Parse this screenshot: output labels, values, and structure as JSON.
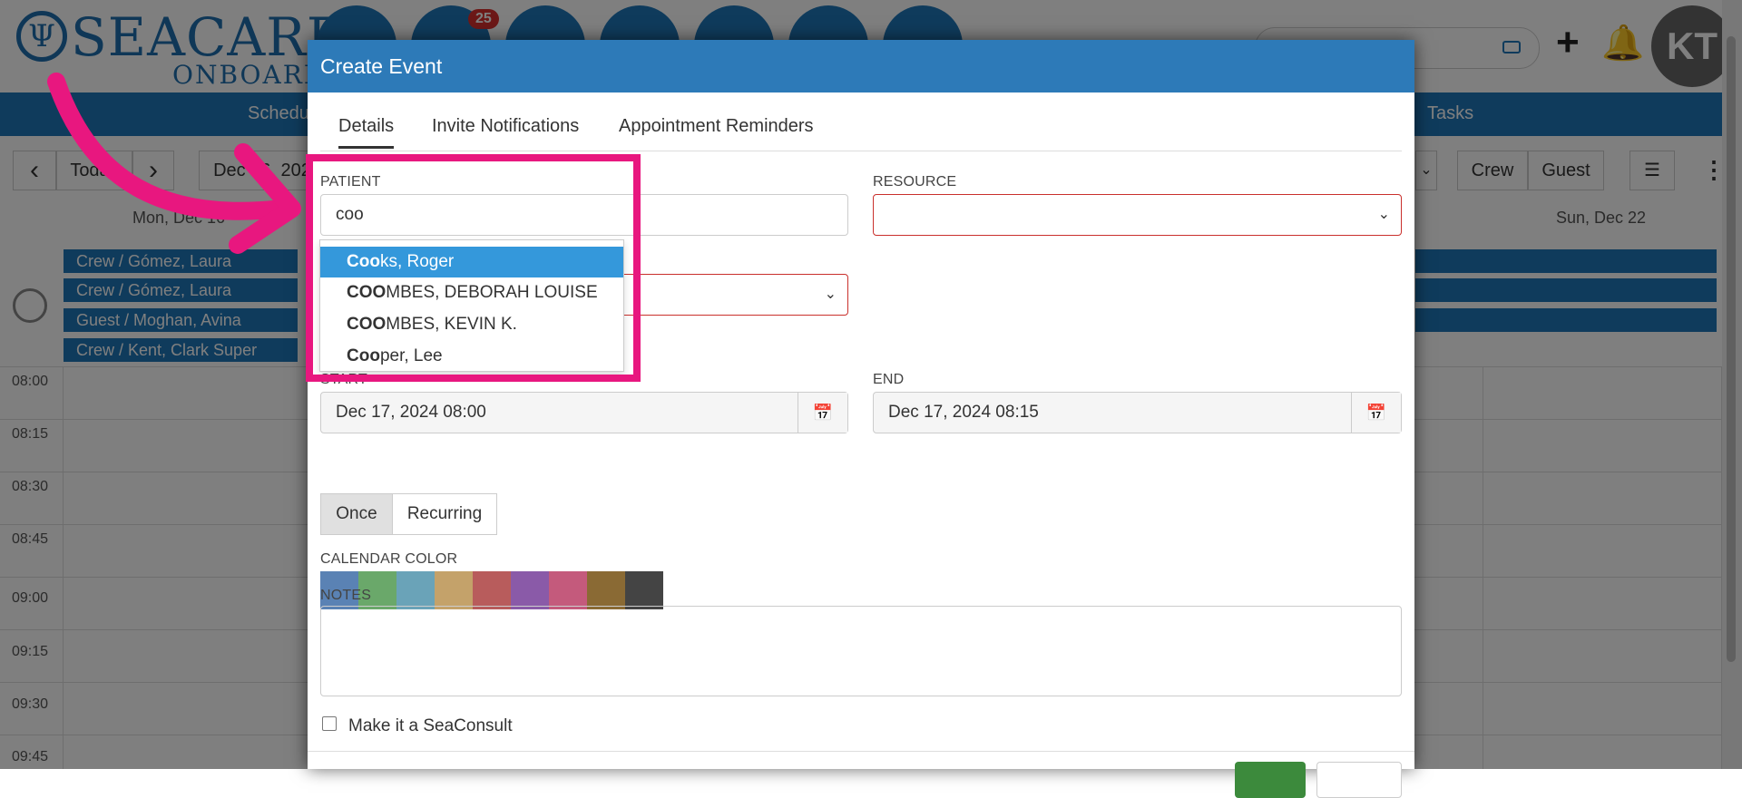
{
  "app": {
    "logo_text": "SEACARE",
    "logo_sub": "ONBOARD",
    "logo_mark": "Ψ",
    "notification_badge": "25",
    "avatar_initials": "KT",
    "tab_schedule": "Schedu",
    "tab_tasks": "Tasks",
    "nav_today": "Today",
    "date_range": "Dec 16, 202",
    "prev_icon": "‹",
    "next_icon": "›",
    "filter_crew": "Crew",
    "filter_guest": "Guest",
    "day_first": "Mon, Dec 16",
    "day_last": "Sun, Dec 22",
    "events": [
      "Crew / Gómez, Laura",
      "Crew / Gómez, Laura",
      "Guest / Moghan, Avina",
      "Crew / Kent, Clark Super"
    ],
    "times": [
      "08:00",
      "08:15",
      "08:30",
      "08:45",
      "09:00",
      "09:15",
      "09:30",
      "09:45"
    ]
  },
  "modal": {
    "title": "Create Event",
    "tabs": [
      "Details",
      "Invite Notifications",
      "Appointment Reminders"
    ],
    "patient_label": "PATIENT",
    "patient_value": "coo",
    "resource_label": "RESOURCE",
    "start_label": "START",
    "start_value": "Dec 17, 2024 08:00",
    "end_label": "END",
    "end_value": "Dec 17, 2024 08:15",
    "once_label": "Once",
    "recurring_label": "Recurring",
    "color_label": "CALENDAR COLOR",
    "colors": [
      "#5a82b4",
      "#6aa86a",
      "#6aa3b8",
      "#c4a26a",
      "#b85c5c",
      "#8a5aa8",
      "#c45a7c",
      "#8a6a34",
      "#444444"
    ],
    "notes_label": "NOTES",
    "seaconsult_label": "Make it a SeaConsult"
  },
  "dropdown": {
    "items": [
      {
        "match": "Coo",
        "rest": "ks, Roger"
      },
      {
        "match": "COO",
        "rest": "MBES, DEBORAH LOUISE"
      },
      {
        "match": "COO",
        "rest": "MBES, KEVIN K."
      },
      {
        "match": "Coo",
        "rest": "per, Lee"
      }
    ]
  },
  "annotation": {
    "highlight_color": "#e8177f"
  }
}
